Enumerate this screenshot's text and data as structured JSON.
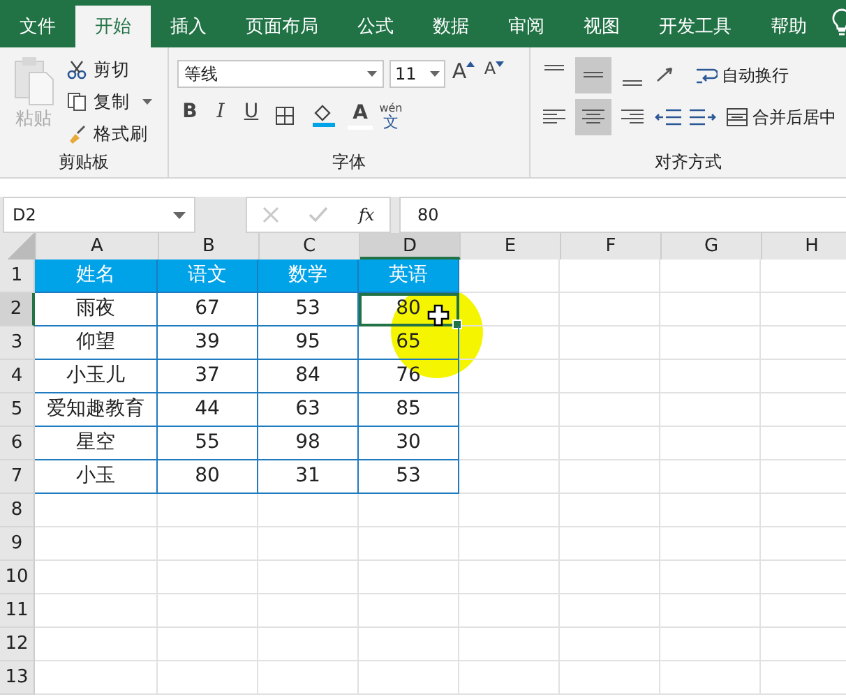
{
  "tabs": [
    {
      "label": "文件",
      "selected": false
    },
    {
      "label": "开始",
      "selected": true
    },
    {
      "label": "插入",
      "selected": false
    },
    {
      "label": "页面布局",
      "selected": false
    },
    {
      "label": "公式",
      "selected": false
    },
    {
      "label": "数据",
      "selected": false
    },
    {
      "label": "审阅",
      "selected": false
    },
    {
      "label": "视图",
      "selected": false
    },
    {
      "label": "开发工具",
      "selected": false
    },
    {
      "label": "帮助",
      "selected": false
    }
  ],
  "ribbon": {
    "clipboard": {
      "paste": "粘贴",
      "paste_disabled": true,
      "cut": "剪切",
      "copy": "复制",
      "format_painter": "格式刷",
      "label": "剪贴板"
    },
    "font": {
      "name": "等线",
      "size": "11",
      "grow": "A",
      "shrink": "A",
      "bold": "B",
      "italic": "I",
      "underline": "U",
      "font_color": "A",
      "phonetic_top": "wén",
      "phonetic_bottom": "文",
      "label": "字体"
    },
    "alignment": {
      "vertical": [
        {
          "selected": false
        },
        {
          "selected": true
        },
        {
          "selected": false
        }
      ],
      "horizontal": [
        {
          "selected": false
        },
        {
          "selected": true
        },
        {
          "selected": false
        }
      ],
      "wrap_text": "自动换行",
      "merge_center": "合并后居中",
      "label": "对齐方式"
    }
  },
  "formula_bar": {
    "name_box": "D2",
    "fx": "fx",
    "value": "80"
  },
  "sheet": {
    "columns": [
      {
        "label": "A",
        "selected": false
      },
      {
        "label": "B",
        "selected": false
      },
      {
        "label": "C",
        "selected": false
      },
      {
        "label": "D",
        "selected": true
      },
      {
        "label": "E",
        "selected": false
      },
      {
        "label": "F",
        "selected": false
      },
      {
        "label": "G",
        "selected": false
      },
      {
        "label": "H",
        "selected": false
      }
    ],
    "rows": [
      {
        "label": "1",
        "selected": false,
        "kind": "header",
        "cells": [
          {
            "text": "姓名",
            "selected": false
          },
          {
            "text": "语文",
            "selected": false
          },
          {
            "text": "数学",
            "selected": false
          },
          {
            "text": "英语",
            "selected": false
          }
        ]
      },
      {
        "label": "2",
        "selected": true,
        "kind": "data",
        "cells": [
          {
            "text": "雨夜",
            "selected": false
          },
          {
            "text": "67",
            "selected": false
          },
          {
            "text": "53",
            "selected": false
          },
          {
            "text": "80",
            "selected": true
          }
        ]
      },
      {
        "label": "3",
        "selected": false,
        "kind": "data",
        "cells": [
          {
            "text": "仰望",
            "selected": false
          },
          {
            "text": "39",
            "selected": false
          },
          {
            "text": "95",
            "selected": false
          },
          {
            "text": "65",
            "selected": false
          }
        ]
      },
      {
        "label": "4",
        "selected": false,
        "kind": "data",
        "cells": [
          {
            "text": "小玉儿",
            "selected": false
          },
          {
            "text": "37",
            "selected": false
          },
          {
            "text": "84",
            "selected": false
          },
          {
            "text": "76",
            "selected": false
          }
        ]
      },
      {
        "label": "5",
        "selected": false,
        "kind": "data",
        "cells": [
          {
            "text": "爱知趣教育",
            "selected": false
          },
          {
            "text": "44",
            "selected": false
          },
          {
            "text": "63",
            "selected": false
          },
          {
            "text": "85",
            "selected": false
          }
        ]
      },
      {
        "label": "6",
        "selected": false,
        "kind": "data",
        "cells": [
          {
            "text": "星空",
            "selected": false
          },
          {
            "text": "55",
            "selected": false
          },
          {
            "text": "98",
            "selected": false
          },
          {
            "text": "30",
            "selected": false
          }
        ]
      },
      {
        "label": "7",
        "selected": false,
        "kind": "data",
        "cells": [
          {
            "text": "小玉",
            "selected": false
          },
          {
            "text": "80",
            "selected": false
          },
          {
            "text": "31",
            "selected": false
          },
          {
            "text": "53",
            "selected": false
          }
        ]
      },
      {
        "label": "8",
        "selected": false,
        "kind": "empty"
      },
      {
        "label": "9",
        "selected": false,
        "kind": "empty"
      },
      {
        "label": "10",
        "selected": false,
        "kind": "empty"
      },
      {
        "label": "11",
        "selected": false,
        "kind": "empty"
      },
      {
        "label": "12",
        "selected": false,
        "kind": "empty"
      },
      {
        "label": "13",
        "selected": false,
        "kind": "empty"
      }
    ]
  }
}
